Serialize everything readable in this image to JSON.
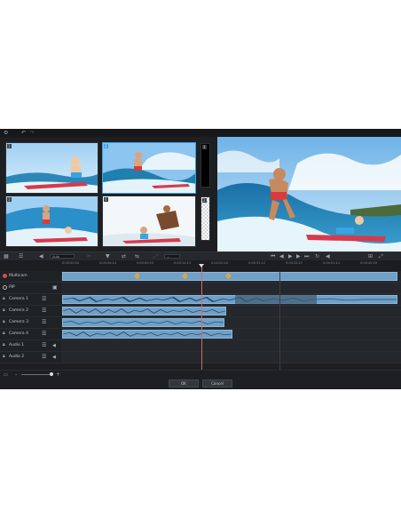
{
  "preview": {
    "cameras": [
      {
        "num": "1",
        "selected": false
      },
      {
        "num": "2",
        "selected": true
      },
      {
        "num": "3",
        "selected": false
      },
      {
        "num": "4",
        "selected": false
      }
    ],
    "pip_slots": [
      {
        "num": "1"
      },
      {
        "num": "2"
      }
    ]
  },
  "timeline": {
    "timecodes": [
      "0:00:00:00",
      "0:00:06:14",
      "0:00:09:20",
      "0:00:14:13",
      "0:00:20:20",
      "0:00:32:12",
      "0:00:32:27",
      "0:00:51:11",
      "0:00:42:20"
    ],
    "tracks": [
      {
        "name": "Multicam",
        "icon": "record-icon"
      },
      {
        "name": "PIP",
        "icon": "record-icon"
      },
      {
        "name": "Camera 1",
        "icon": "lock-icon"
      },
      {
        "name": "Camera 2",
        "icon": "lock-icon"
      },
      {
        "name": "Camera 3",
        "icon": "lock-icon"
      },
      {
        "name": "Camera 4",
        "icon": "lock-icon"
      },
      {
        "name": "Audio 1",
        "icon": "lock-icon"
      },
      {
        "name": "Audio 2",
        "icon": "lock-icon"
      }
    ]
  },
  "toolbar": {
    "audio_select": "Auto",
    "display_select": "—"
  },
  "buttons": {
    "ok": "OK",
    "cancel": "Cancel"
  },
  "colors": {
    "accent": "#3aa3e3",
    "clip": "#6fa0c8",
    "record": "#d94c4c",
    "playhead": "#d56a6a"
  }
}
